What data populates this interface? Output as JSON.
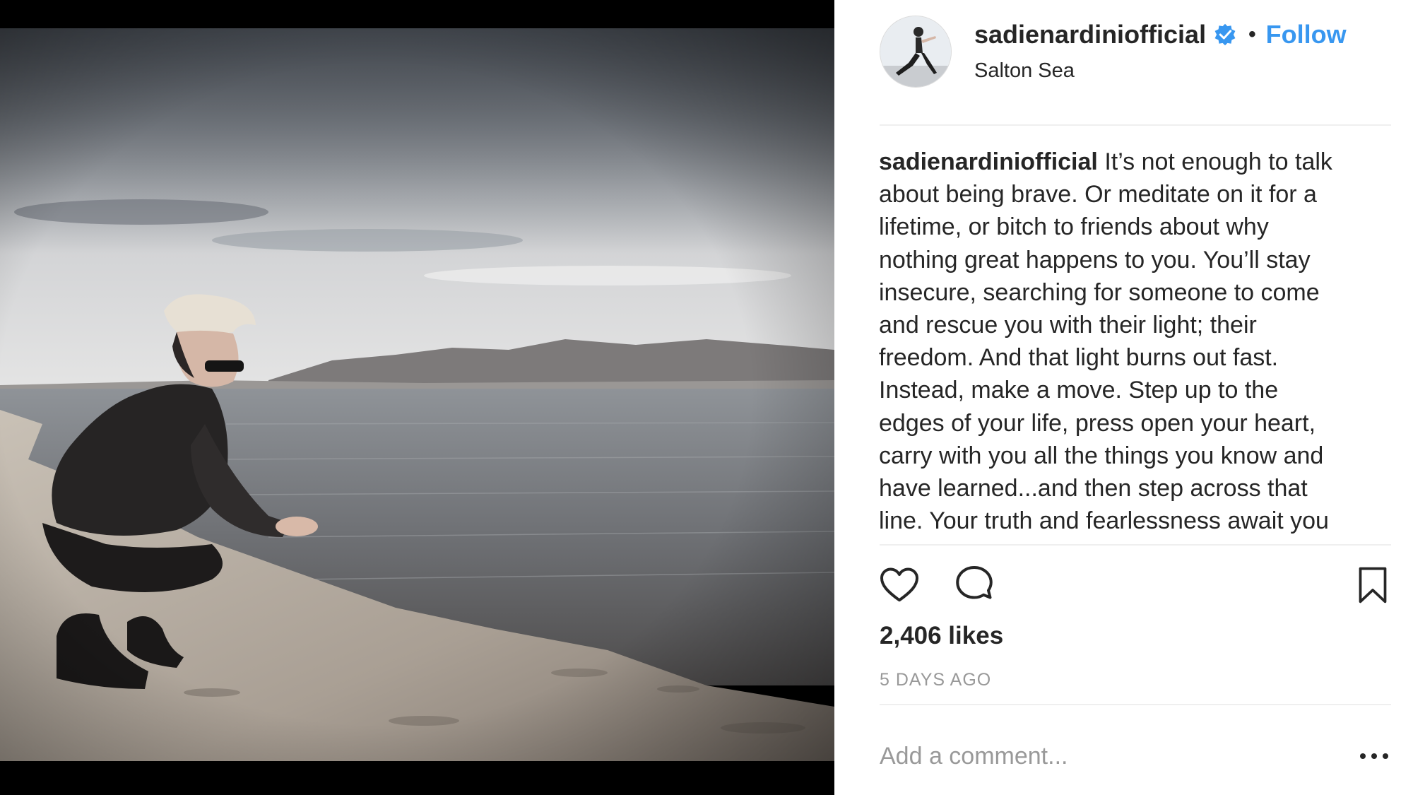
{
  "post": {
    "username": "sadienardiniofficial",
    "separator": "•",
    "follow_label": "Follow",
    "location": "Salton Sea",
    "caption_lines": [
      "It’s not enough to talk",
      "about being brave. Or meditate on it for a",
      "lifetime, or bitch to friends about why",
      "nothing great happens to you. You’ll stay",
      "insecure, searching for someone to come",
      "and rescue you with their light; their",
      "freedom. And that light burns out fast.",
      "Instead, make a move. Step up to the",
      "edges of your life, press open your heart,",
      "carry with you all the things you know and",
      "have learned...and then step across that",
      "line. Your truth and fearlessness await you"
    ],
    "likes": "2,406 likes",
    "time_ago": "5 DAYS AGO",
    "comment_placeholder": "Add a comment..."
  },
  "icons": {
    "verified": "verified-badge-icon",
    "like": "heart-icon",
    "comment": "comment-bubble-icon",
    "save": "bookmark-icon",
    "more": "more-options-icon"
  },
  "colors": {
    "link_blue": "#3897f0",
    "verified_blue": "#3897f0",
    "text": "#262626",
    "muted": "#999999",
    "divider": "#efefef"
  }
}
